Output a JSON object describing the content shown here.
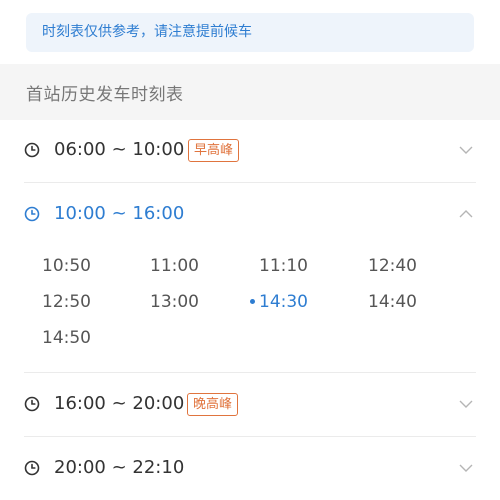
{
  "notice": {
    "text": "时刻表仅供参考，请注意提前候车"
  },
  "section": {
    "title": "首站历史发车时刻表"
  },
  "periods": [
    {
      "time": "06:00 ~ 10:00",
      "badge": "早高峰",
      "expanded": false
    },
    {
      "time": "10:00 ~ 16:00",
      "badge": "",
      "expanded": true,
      "slots": [
        "10:50",
        "11:00",
        "11:10",
        "12:40",
        "12:50",
        "13:00",
        "14:30",
        "14:40",
        "14:50"
      ],
      "current_slot": "14:30"
    },
    {
      "time": "16:00 ~ 20:00",
      "badge": "晚高峰",
      "expanded": false
    },
    {
      "time": "20:00 ~ 22:10",
      "badge": "",
      "expanded": false
    }
  ],
  "colors": {
    "accent": "#2e7dd1",
    "peak_badge": "#e0743e",
    "notice_bg": "#eef4fb"
  },
  "icons": {
    "period": "clock-icon",
    "collapsed": "chevron-down-icon",
    "expanded": "chevron-up-icon"
  }
}
